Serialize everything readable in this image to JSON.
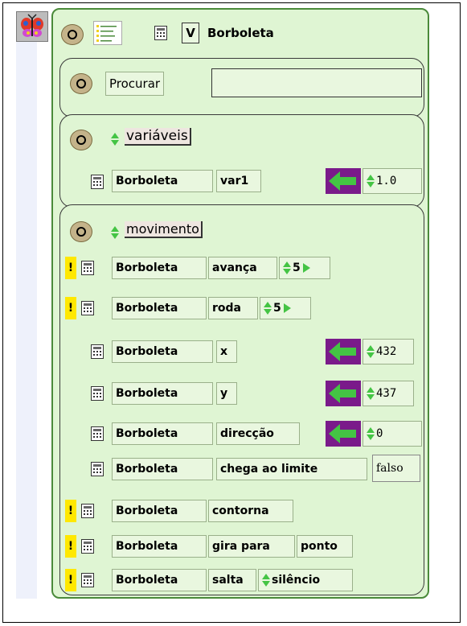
{
  "viewer": {
    "title": "Borboleta",
    "v_label": "V"
  },
  "search": {
    "label": "Procurar",
    "value": ""
  },
  "variables": {
    "category": "variáveis",
    "row": {
      "object": "Borboleta",
      "name": "var1",
      "value": "1.0"
    }
  },
  "movement": {
    "category": "movimento",
    "commands": [
      {
        "object": "Borboleta",
        "name": "avança",
        "arg": "5"
      },
      {
        "object": "Borboleta",
        "name": "roda",
        "arg": "5"
      }
    ],
    "x": {
      "object": "Borboleta",
      "name": "x",
      "value": "432"
    },
    "y": {
      "object": "Borboleta",
      "name": "y",
      "value": "437"
    },
    "heading": {
      "object": "Borboleta",
      "name": "direcção",
      "value": "0"
    },
    "edge": {
      "object": "Borboleta",
      "name": "chega ao limite",
      "value": "falso"
    },
    "bounce": {
      "object": "Borboleta",
      "name": "contorna"
    },
    "turn_to": {
      "object": "Borboleta",
      "name": "gira para",
      "arg": "ponto"
    },
    "jump": {
      "object": "Borboleta",
      "name": "salta",
      "arg": "silêncio"
    }
  },
  "icons": {
    "colors": {
      "accent_green": "#44c444",
      "arrow_bg": "#7a1a8a",
      "panel_bg": "#dff5d3",
      "warn": "#ffe800"
    }
  }
}
